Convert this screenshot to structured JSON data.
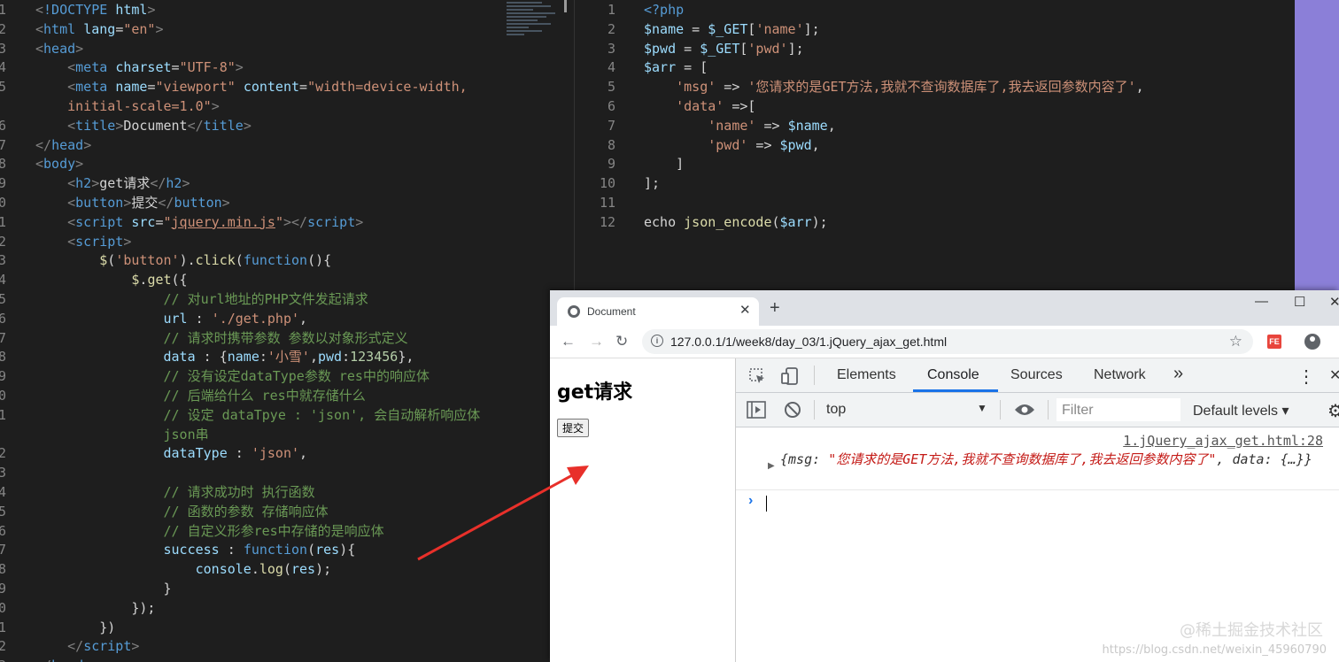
{
  "left_editor": {
    "lines": [
      {
        "n": "1",
        "parts": [
          [
            "br",
            "<"
          ],
          [
            "tg",
            "!DOCTYPE "
          ],
          [
            "at",
            "html"
          ],
          [
            "br",
            ">"
          ]
        ]
      },
      {
        "n": "2",
        "parts": [
          [
            "br",
            "<"
          ],
          [
            "tg",
            "html "
          ],
          [
            "at",
            "lang"
          ],
          [
            "pl",
            "="
          ],
          [
            "st",
            "\"en\""
          ],
          [
            "br",
            ">"
          ]
        ]
      },
      {
        "n": "3",
        "parts": [
          [
            "br",
            "<"
          ],
          [
            "tg",
            "head"
          ],
          [
            "br",
            ">"
          ]
        ]
      },
      {
        "n": "4",
        "parts": [
          [
            "pl",
            "    "
          ],
          [
            "br",
            "<"
          ],
          [
            "tg",
            "meta "
          ],
          [
            "at",
            "charset"
          ],
          [
            "pl",
            "="
          ],
          [
            "st",
            "\"UTF-8\""
          ],
          [
            "br",
            ">"
          ]
        ]
      },
      {
        "n": "5",
        "parts": [
          [
            "pl",
            "    "
          ],
          [
            "br",
            "<"
          ],
          [
            "tg",
            "meta "
          ],
          [
            "at",
            "name"
          ],
          [
            "pl",
            "="
          ],
          [
            "st",
            "\"viewport\" "
          ],
          [
            "at",
            "content"
          ],
          [
            "pl",
            "="
          ],
          [
            "st",
            "\"width=device-width,"
          ]
        ]
      },
      {
        "n": "",
        "parts": [
          [
            "st",
            "    initial-scale=1.0\""
          ],
          [
            "br",
            ">"
          ]
        ]
      },
      {
        "n": "6",
        "parts": [
          [
            "pl",
            "    "
          ],
          [
            "br",
            "<"
          ],
          [
            "tg",
            "title"
          ],
          [
            "br",
            ">"
          ],
          [
            "pl",
            "Document"
          ],
          [
            "br",
            "</"
          ],
          [
            "tg",
            "title"
          ],
          [
            "br",
            ">"
          ]
        ]
      },
      {
        "n": "7",
        "parts": [
          [
            "br",
            "</"
          ],
          [
            "tg",
            "head"
          ],
          [
            "br",
            ">"
          ]
        ]
      },
      {
        "n": "8",
        "parts": [
          [
            "br",
            "<"
          ],
          [
            "tg",
            "body"
          ],
          [
            "br",
            ">"
          ]
        ]
      },
      {
        "n": "9",
        "parts": [
          [
            "pl",
            "    "
          ],
          [
            "br",
            "<"
          ],
          [
            "tg",
            "h2"
          ],
          [
            "br",
            ">"
          ],
          [
            "pl",
            "get请求"
          ],
          [
            "br",
            "</"
          ],
          [
            "tg",
            "h2"
          ],
          [
            "br",
            ">"
          ]
        ]
      },
      {
        "n": "0",
        "parts": [
          [
            "pl",
            "    "
          ],
          [
            "br",
            "<"
          ],
          [
            "tg",
            "button"
          ],
          [
            "br",
            ">"
          ],
          [
            "pl",
            "提交"
          ],
          [
            "br",
            "</"
          ],
          [
            "tg",
            "button"
          ],
          [
            "br",
            ">"
          ]
        ]
      },
      {
        "n": "1",
        "parts": [
          [
            "pl",
            "    "
          ],
          [
            "br",
            "<"
          ],
          [
            "tg",
            "script "
          ],
          [
            "at",
            "src"
          ],
          [
            "pl",
            "="
          ],
          [
            "st",
            "\""
          ],
          [
            "stu",
            "jquery.min.js"
          ],
          [
            "st",
            "\""
          ],
          [
            "br",
            "></"
          ],
          [
            "tg",
            "script"
          ],
          [
            "br",
            ">"
          ]
        ]
      },
      {
        "n": "2",
        "parts": [
          [
            "pl",
            "    "
          ],
          [
            "br",
            "<"
          ],
          [
            "tg",
            "script"
          ],
          [
            "br",
            ">"
          ]
        ]
      },
      {
        "n": "3",
        "parts": [
          [
            "pl",
            "        "
          ],
          [
            "fn",
            "$"
          ],
          [
            "pl",
            "("
          ],
          [
            "st",
            "'button'"
          ],
          [
            "pl",
            ")."
          ],
          [
            "fn",
            "click"
          ],
          [
            "pl",
            "("
          ],
          [
            "kw",
            "function"
          ],
          [
            "pl",
            "(){"
          ]
        ]
      },
      {
        "n": "4",
        "parts": [
          [
            "pl",
            "            "
          ],
          [
            "fn",
            "$"
          ],
          [
            "pl",
            "."
          ],
          [
            "fn",
            "get"
          ],
          [
            "pl",
            "({"
          ]
        ]
      },
      {
        "n": "5",
        "parts": [
          [
            "cm",
            "                // 对url地址的PHP文件发起请求"
          ]
        ]
      },
      {
        "n": "6",
        "parts": [
          [
            "pl",
            "                "
          ],
          [
            "vr",
            "url"
          ],
          [
            "pl",
            " : "
          ],
          [
            "st",
            "'./get.php'"
          ],
          [
            "pl",
            ","
          ]
        ]
      },
      {
        "n": "7",
        "parts": [
          [
            "cm",
            "                // 请求时携带参数 参数以对象形式定义"
          ]
        ]
      },
      {
        "n": "8",
        "parts": [
          [
            "pl",
            "                "
          ],
          [
            "vr",
            "data"
          ],
          [
            "pl",
            " : {"
          ],
          [
            "vr",
            "name"
          ],
          [
            "pl",
            ":"
          ],
          [
            "st",
            "'小雪'"
          ],
          [
            "pl",
            ","
          ],
          [
            "vr",
            "pwd"
          ],
          [
            "pl",
            ":"
          ],
          [
            "num",
            "123456"
          ],
          [
            "pl",
            "},"
          ]
        ]
      },
      {
        "n": "9",
        "parts": [
          [
            "cm",
            "                // 没有设定dataType参数 res中的响应体"
          ]
        ]
      },
      {
        "n": "0",
        "parts": [
          [
            "cm",
            "                // 后端给什么 res中就存储什么"
          ]
        ]
      },
      {
        "n": "1",
        "parts": [
          [
            "cm",
            "                // 设定 dataTpye : 'json', 会自动解析响应体"
          ]
        ]
      },
      {
        "n": "",
        "parts": [
          [
            "cm",
            "                json串"
          ]
        ]
      },
      {
        "n": "2",
        "parts": [
          [
            "pl",
            "                "
          ],
          [
            "vr",
            "dataType"
          ],
          [
            "pl",
            " : "
          ],
          [
            "st",
            "'json'"
          ],
          [
            "pl",
            ","
          ]
        ]
      },
      {
        "n": "3",
        "parts": []
      },
      {
        "n": "4",
        "parts": [
          [
            "cm",
            "                // 请求成功时 执行函数"
          ]
        ]
      },
      {
        "n": "5",
        "parts": [
          [
            "cm",
            "                // 函数的参数 存储响应体"
          ]
        ]
      },
      {
        "n": "6",
        "parts": [
          [
            "cm",
            "                // 自定义形参res中存储的是响应体"
          ]
        ]
      },
      {
        "n": "7",
        "parts": [
          [
            "pl",
            "                "
          ],
          [
            "vr",
            "success"
          ],
          [
            "pl",
            " : "
          ],
          [
            "kw",
            "function"
          ],
          [
            "pl",
            "("
          ],
          [
            "vr",
            "res"
          ],
          [
            "pl",
            "){"
          ]
        ]
      },
      {
        "n": "8",
        "parts": [
          [
            "pl",
            "                    "
          ],
          [
            "vr",
            "console"
          ],
          [
            "pl",
            "."
          ],
          [
            "fn",
            "log"
          ],
          [
            "pl",
            "("
          ],
          [
            "vr",
            "res"
          ],
          [
            "pl",
            ");"
          ]
        ]
      },
      {
        "n": "9",
        "parts": [
          [
            "pl",
            "                }"
          ]
        ]
      },
      {
        "n": "0",
        "parts": [
          [
            "pl",
            "            });"
          ]
        ]
      },
      {
        "n": "1",
        "parts": [
          [
            "pl",
            "        })"
          ]
        ]
      },
      {
        "n": "2",
        "parts": [
          [
            "pl",
            "    "
          ],
          [
            "br",
            "</"
          ],
          [
            "tg",
            "script"
          ],
          [
            "br",
            ">"
          ]
        ]
      },
      {
        "n": "3",
        "parts": [
          [
            "br",
            "</"
          ],
          [
            "tg",
            "head"
          ],
          [
            "br",
            ">"
          ]
        ]
      }
    ]
  },
  "right_editor": {
    "lines": [
      {
        "n": "1",
        "parts": [
          [
            "tg",
            "<?php"
          ]
        ]
      },
      {
        "n": "2",
        "parts": [
          [
            "vr",
            "$name"
          ],
          [
            "pl",
            " = "
          ],
          [
            "vr",
            "$_GET"
          ],
          [
            "pl",
            "["
          ],
          [
            "st",
            "'name'"
          ],
          [
            "pl",
            "];"
          ]
        ]
      },
      {
        "n": "3",
        "parts": [
          [
            "vr",
            "$pwd"
          ],
          [
            "pl",
            " = "
          ],
          [
            "vr",
            "$_GET"
          ],
          [
            "pl",
            "["
          ],
          [
            "st",
            "'pwd'"
          ],
          [
            "pl",
            "];"
          ]
        ]
      },
      {
        "n": "4",
        "parts": [
          [
            "vr",
            "$arr"
          ],
          [
            "pl",
            " = ["
          ]
        ]
      },
      {
        "n": "5",
        "parts": [
          [
            "pl",
            "    "
          ],
          [
            "st",
            "'msg'"
          ],
          [
            "pl",
            " => "
          ],
          [
            "st",
            "'您请求的是GET方法,我就不查询数据库了,我去返回参数内容了'"
          ],
          [
            "pl",
            ","
          ]
        ]
      },
      {
        "n": "6",
        "parts": [
          [
            "pl",
            "    "
          ],
          [
            "st",
            "'data'"
          ],
          [
            "pl",
            " =>["
          ]
        ]
      },
      {
        "n": "7",
        "parts": [
          [
            "pl",
            "        "
          ],
          [
            "st",
            "'name'"
          ],
          [
            "pl",
            " => "
          ],
          [
            "vr",
            "$name"
          ],
          [
            "pl",
            ","
          ]
        ]
      },
      {
        "n": "8",
        "parts": [
          [
            "pl",
            "        "
          ],
          [
            "st",
            "'pwd'"
          ],
          [
            "pl",
            " => "
          ],
          [
            "vr",
            "$pwd"
          ],
          [
            "pl",
            ","
          ]
        ]
      },
      {
        "n": "9",
        "parts": [
          [
            "pl",
            "    ]"
          ]
        ]
      },
      {
        "n": "10",
        "parts": [
          [
            "pl",
            "];"
          ]
        ]
      },
      {
        "n": "11",
        "parts": []
      },
      {
        "n": "12",
        "parts": [
          [
            "pl",
            "echo "
          ],
          [
            "fn",
            "json_encode"
          ],
          [
            "pl",
            "("
          ],
          [
            "vr",
            "$arr"
          ],
          [
            "pl",
            ");"
          ]
        ]
      }
    ]
  },
  "browser": {
    "tab_title": "Document",
    "tab_close": "✕",
    "new_tab": "+",
    "win_min": "—",
    "win_max": "☐",
    "win_close": "✕",
    "back": "←",
    "forward": "→",
    "reload": "↻",
    "info": "i",
    "url": "127.0.0.1/1/week8/day_03/1.jQuery_ajax_get.html",
    "star": "☆",
    "ext": "FE",
    "page": {
      "heading": "get请求",
      "button": "提交"
    },
    "devtools": {
      "tabs": [
        "Elements",
        "Console",
        "Sources",
        "Network"
      ],
      "more": "»",
      "menu": "⋮",
      "close": "✕",
      "context": "top",
      "context_arrow": "▼",
      "filter_placeholder": "Filter",
      "levels": "Default levels ▾",
      "gear": "⚙",
      "source_link": "1.jQuery_ajax_get.html:28",
      "log_prefix": "{msg: ",
      "log_msg": "\"您请求的是GET方法,我就不查询数据库了,我去返回参数内容了\"",
      "log_suffix": ", data: {…}}",
      "prompt": "›"
    }
  },
  "watermark": "@稀土掘金技术社区",
  "watermark_url": "https://blog.csdn.net/weixin_45960790"
}
